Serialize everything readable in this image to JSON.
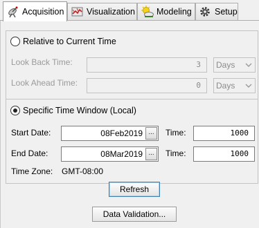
{
  "tabs": [
    {
      "label": "Acquisition",
      "icon": "satellite-dish-icon",
      "active": true
    },
    {
      "label": "Visualization",
      "icon": "visualization-map-icon",
      "active": false
    },
    {
      "label": "Modeling",
      "icon": "modeling-sun-cloud-icon",
      "active": false
    },
    {
      "label": "Setup",
      "icon": "gear-icon",
      "active": false
    }
  ],
  "relative": {
    "label": "Relative to Current Time",
    "look_back_label": "Look Back Time:",
    "look_back_value": "3",
    "look_back_unit": "Days",
    "look_ahead_label": "Look Ahead Time:",
    "look_ahead_value": "0",
    "look_ahead_unit": "Days"
  },
  "specific": {
    "label": "Specific Time Window (Local)",
    "start_date_label": "Start Date:",
    "start_date": "08Feb2019",
    "start_time_label": "Time:",
    "start_time": "1000",
    "end_date_label": "End Date:",
    "end_date": "08Mar2019",
    "end_time_label": "Time:",
    "end_time": "1000",
    "timezone_label": "Time Zone:",
    "timezone": "GMT-08:00"
  },
  "ellipsis": "...",
  "buttons": {
    "refresh": "Refresh",
    "data_validation": "Data Validation..."
  }
}
